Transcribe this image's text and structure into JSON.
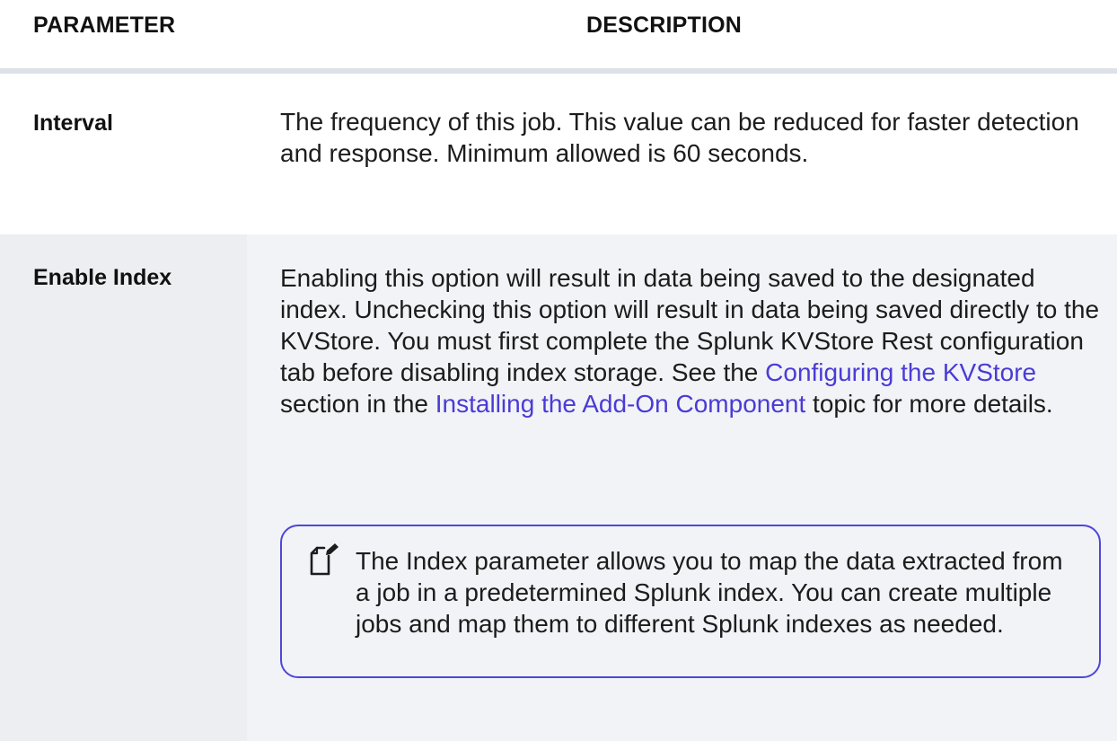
{
  "table": {
    "header": {
      "parameter": "PARAMETER",
      "description": "DESCRIPTION"
    },
    "rows": [
      {
        "name": "Interval",
        "description": "The frequency of this job. This value can be reduced for faster detection and response. Minimum allowed is 60 seconds."
      },
      {
        "name": "Enable Index",
        "description_parts": {
          "text1": "Enabling this option will result in data being saved to the designated index. Unchecking this option will result in data being saved directly to the KVStore.  You must first complete the Splunk KVStore Rest configuration tab before disabling index storage. See the ",
          "link1": "Configuring the KVStore",
          "text2": " section in the ",
          "link2": "Installing the Add-On Component",
          "text3": " topic for more details."
        },
        "note": {
          "icon": "note-pencil-icon",
          "text": "The Index parameter allows you to map the data extracted from a job in a predetermined Splunk index. You can create multiple jobs and map them to different Splunk indexes as needed."
        }
      }
    ]
  },
  "colors": {
    "link": "#4a3bd6",
    "note_border": "#4f46d9",
    "row_shade": "#f1f3f6",
    "divider": "#dde2e8"
  }
}
